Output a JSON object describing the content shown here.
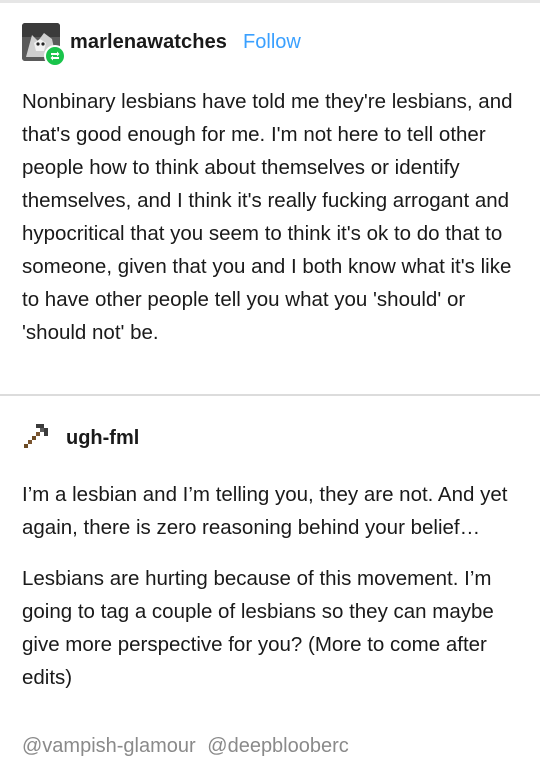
{
  "post1": {
    "username": "marlenawatches",
    "follow_label": "Follow",
    "text": "Nonbinary lesbians have told me they're lesbians, and that's good enough for me.  I'm not here to tell other people how to think about themselves or identify themselves, and I think it's really fucking arrogant and hypocritical that you seem to think it's ok to do that to someone, given that you and I both know what it's like to have other people tell you what you 'should' or 'should not' be."
  },
  "post2": {
    "username": "ugh-fml",
    "paragraph1": "I’m a lesbian and I’m telling you, they are not. And yet again, there is zero reasoning behind your belief…",
    "paragraph2": "Lesbians are hurting because of this movement. I’m going to tag a couple of lesbians so they can maybe give more perspective for you? (More to come after edits)",
    "mentions": [
      "@vampish-glamour",
      "@deepblooberc"
    ]
  },
  "icons": {
    "reblog": "reblog-icon",
    "pickaxe": "pickaxe-icon"
  },
  "colors": {
    "follow": "#3aa0ff",
    "reblog_badge": "#19c44b",
    "mentions": "#8a8a8a"
  }
}
